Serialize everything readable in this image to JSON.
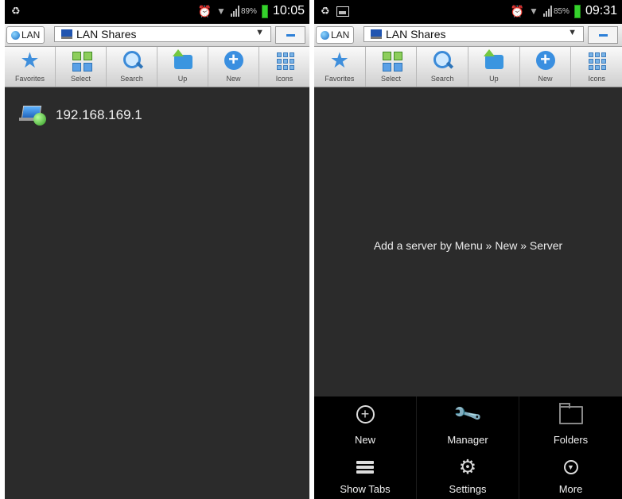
{
  "colors": {
    "background": "#2b2b2b",
    "statusbar": "#000000",
    "toolbar": "#e6e6e6",
    "accent_blue": "#3a8fe0",
    "battery_green": "#35d22c",
    "menu_bg": "#000000"
  },
  "left": {
    "status": {
      "battery_pct": "89%",
      "time": "10:05"
    },
    "location": {
      "lan_tab": "LAN",
      "share_select": "LAN Shares"
    },
    "toolbar": [
      "Favorites",
      "Select",
      "Search",
      "Up",
      "New",
      "Icons"
    ],
    "servers": [
      {
        "label": "192.168.169.1"
      }
    ]
  },
  "right": {
    "status": {
      "battery_pct": "85%",
      "time": "09:31"
    },
    "location": {
      "lan_tab": "LAN",
      "share_select": "LAN Shares"
    },
    "toolbar": [
      "Favorites",
      "Select",
      "Search",
      "Up",
      "New",
      "Icons"
    ],
    "empty_message": "Add a server by Menu » New » Server",
    "menu": [
      {
        "label": "New",
        "icon": "plus-circle-icon"
      },
      {
        "label": "Manager",
        "icon": "wrench-icon"
      },
      {
        "label": "Folders",
        "icon": "folder-icon"
      },
      {
        "label": "Show Tabs",
        "icon": "tabs-icon"
      },
      {
        "label": "Settings",
        "icon": "gear-icon"
      },
      {
        "label": "More",
        "icon": "chevron-down-circle-icon"
      }
    ]
  }
}
